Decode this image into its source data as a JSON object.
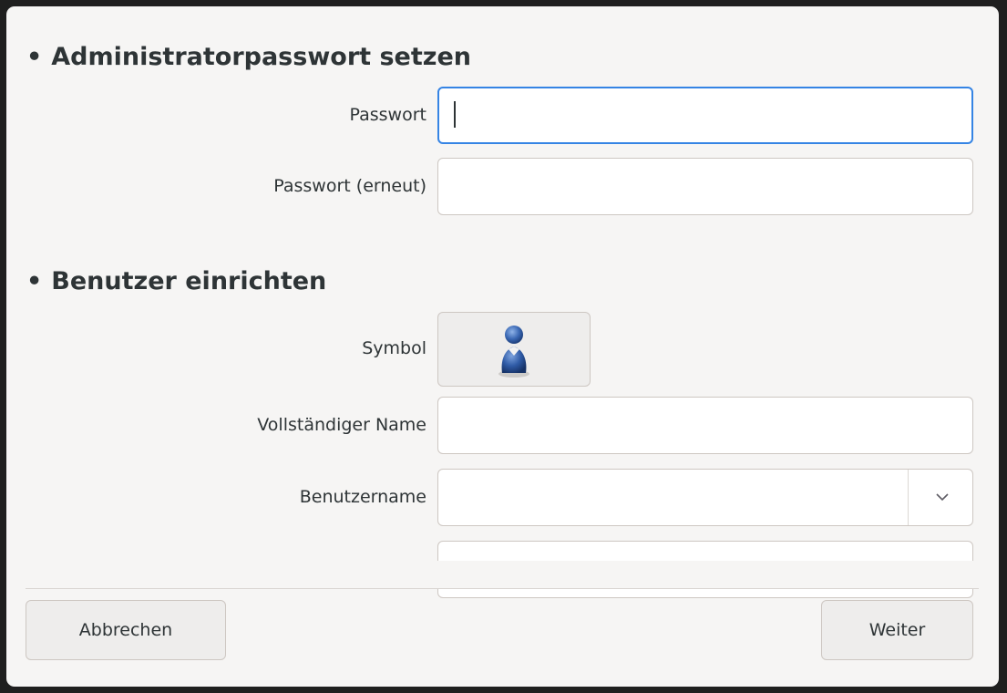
{
  "admin_section": {
    "heading": "Administratorpasswort setzen",
    "password_label": "Passwort",
    "password_value": "",
    "password_repeat_label": "Passwort (erneut)",
    "password_repeat_value": ""
  },
  "user_section": {
    "heading": "Benutzer einrichten",
    "icon_label": "Symbol",
    "icon_name": "user-avatar-icon",
    "fullname_label": "Vollständiger Name",
    "fullname_value": "",
    "username_label": "Benutzername",
    "username_value": ""
  },
  "footer": {
    "cancel_label": "Abbrechen",
    "next_label": "Weiter"
  },
  "colors": {
    "accent": "#3584e4",
    "background": "#f6f5f4",
    "text": "#2e3436",
    "avatar": "#2b5797"
  }
}
